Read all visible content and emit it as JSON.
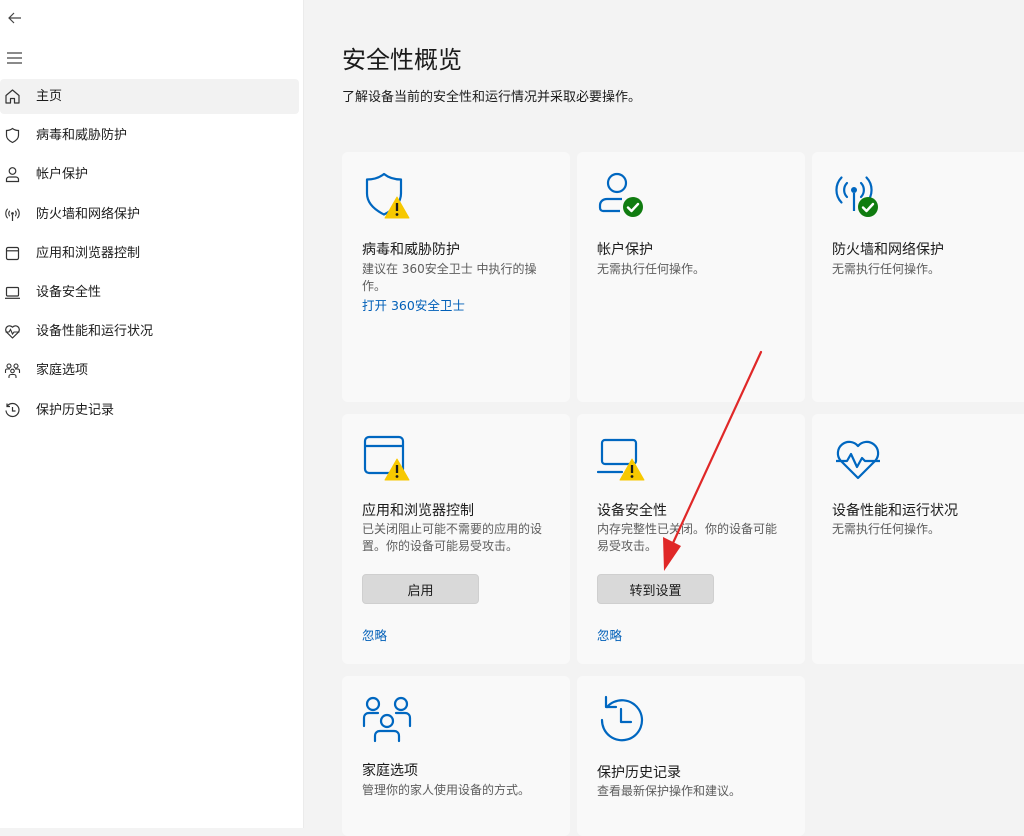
{
  "sidebar": {
    "top_icons": [
      "back-arrow-icon",
      "hamburger-menu-icon"
    ],
    "items": [
      {
        "label": "主页",
        "icon": "home-icon",
        "active": true
      },
      {
        "label": "病毒和威胁防护",
        "icon": "shield-icon"
      },
      {
        "label": "帐户保护",
        "icon": "person-icon"
      },
      {
        "label": "防火墙和网络保护",
        "icon": "wifi-antenna-icon"
      },
      {
        "label": "应用和浏览器控制",
        "icon": "app-window-icon"
      },
      {
        "label": "设备安全性",
        "icon": "laptop-icon"
      },
      {
        "label": "设备性能和运行状况",
        "icon": "heart-pulse-icon"
      },
      {
        "label": "家庭选项",
        "icon": "family-icon"
      },
      {
        "label": "保护历史记录",
        "icon": "history-icon"
      }
    ]
  },
  "main": {
    "title": "安全性概览",
    "subtitle": "了解设备当前的安全性和运行情况并采取必要操作。",
    "cards": {
      "virus": {
        "title": "病毒和威胁防护",
        "desc": "建议在 360安全卫士 中执行的操作。",
        "link": "打开 360安全卫士",
        "status": "warning"
      },
      "account": {
        "title": "帐户保护",
        "desc": "无需执行任何操作。",
        "status": "ok"
      },
      "firewall": {
        "title": "防火墙和网络保护",
        "desc": "无需执行任何操作。",
        "status": "ok"
      },
      "app": {
        "title": "应用和浏览器控制",
        "desc": "已关闭阻止可能不需要的应用的设置。你的设备可能易受攻击。",
        "button": "启用",
        "link": "忽略",
        "status": "warning"
      },
      "device": {
        "title": "设备安全性",
        "desc": "内存完整性已关闭。你的设备可能易受攻击。",
        "button": "转到设置",
        "link": "忽略",
        "status": "warning"
      },
      "health": {
        "title": "设备性能和运行状况",
        "desc": "无需执行任何操作。"
      },
      "family": {
        "title": "家庭选项",
        "desc": "管理你的家人使用设备的方式。"
      },
      "history": {
        "title": "保护历史记录",
        "desc": "查看最新保护操作和建议。"
      }
    }
  },
  "annotation": {
    "type": "red-arrow",
    "color": "#e02828"
  },
  "colors": {
    "accent": "#005fb8",
    "icon_blue": "#0067c0",
    "warning": "#f7c800",
    "ok": "#107c10"
  }
}
